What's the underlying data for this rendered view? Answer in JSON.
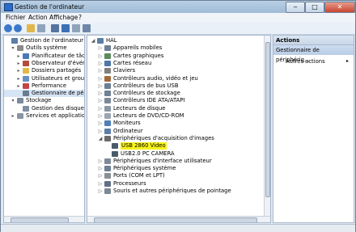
{
  "window": {
    "title": "Gestion de l'ordinateur"
  },
  "menu": [
    "Fichier",
    "Action",
    "Affichage",
    "?"
  ],
  "left_tree": [
    {
      "label": "Gestion de l'ordinateur (local)",
      "indent": 0,
      "exp": "",
      "icon": "computer-icon",
      "color": "#5a7ea8"
    },
    {
      "label": "Outils système",
      "indent": 1,
      "exp": "▾",
      "icon": "tools-icon",
      "color": "#8a8a8a"
    },
    {
      "label": "Planificateur de tâches",
      "indent": 2,
      "exp": "▸",
      "icon": "clock-icon",
      "color": "#4c78b8"
    },
    {
      "label": "Observateur d'événeme",
      "indent": 2,
      "exp": "▸",
      "icon": "event-icon",
      "color": "#b54b3a"
    },
    {
      "label": "Dossiers partagés",
      "indent": 2,
      "exp": "▸",
      "icon": "folder-icon",
      "color": "#e2b84a"
    },
    {
      "label": "Utilisateurs et groupes l",
      "indent": 2,
      "exp": "▸",
      "icon": "users-icon",
      "color": "#6a8fc2"
    },
    {
      "label": "Performance",
      "indent": 2,
      "exp": "▸",
      "icon": "performance-icon",
      "color": "#c24545"
    },
    {
      "label": "Gestionnaire de périphé",
      "indent": 2,
      "exp": "",
      "icon": "device-manager-icon",
      "color": "#6b7c90",
      "selected": true
    },
    {
      "label": "Stockage",
      "indent": 1,
      "exp": "▾",
      "icon": "storage-icon",
      "color": "#7a8a9c"
    },
    {
      "label": "Gestion des disques",
      "indent": 2,
      "exp": "",
      "icon": "disk-icon",
      "color": "#7f8fa2"
    },
    {
      "label": "Services et applications",
      "indent": 1,
      "exp": "▸",
      "icon": "services-icon",
      "color": "#8a94a3"
    }
  ],
  "device_tree": [
    {
      "label": "HAL",
      "indent": 0,
      "exp": "◢",
      "icon": "computer-icon",
      "color": "#5a7ea8"
    },
    {
      "label": "Appareils mobiles",
      "indent": 1,
      "exp": "▷",
      "icon": "mobile-icon",
      "color": "#6e7f93"
    },
    {
      "label": "Cartes graphiques",
      "indent": 1,
      "exp": "▷",
      "icon": "display-adapter-icon",
      "color": "#5b8a5b"
    },
    {
      "label": "Cartes réseau",
      "indent": 1,
      "exp": "▷",
      "icon": "network-icon",
      "color": "#4d77a8"
    },
    {
      "label": "Claviers",
      "indent": 1,
      "exp": "▷",
      "icon": "keyboard-icon",
      "color": "#7f7f7f"
    },
    {
      "label": "Contrôleurs audio, vidéo et jeu",
      "indent": 1,
      "exp": "▷",
      "icon": "audio-icon",
      "color": "#a06b3b"
    },
    {
      "label": "Contrôleurs de bus USB",
      "indent": 1,
      "exp": "▷",
      "icon": "usb-icon",
      "color": "#6b7f95"
    },
    {
      "label": "Contrôleurs de stockage",
      "indent": 1,
      "exp": "▷",
      "icon": "storage-controller-icon",
      "color": "#708096"
    },
    {
      "label": "Contrôleurs IDE ATA/ATAPI",
      "indent": 1,
      "exp": "▷",
      "icon": "ide-icon",
      "color": "#7b8797"
    },
    {
      "label": "Lecteurs de disque",
      "indent": 1,
      "exp": "▷",
      "icon": "drive-icon",
      "color": "#8b97a6"
    },
    {
      "label": "Lecteurs de DVD/CD-ROM",
      "indent": 1,
      "exp": "▷",
      "icon": "dvd-icon",
      "color": "#9aa5b2"
    },
    {
      "label": "Moniteurs",
      "indent": 1,
      "exp": "▷",
      "icon": "monitor-icon",
      "color": "#4f7fb5"
    },
    {
      "label": "Ordinateur",
      "indent": 1,
      "exp": "▷",
      "icon": "computer-icon",
      "color": "#5a7ea8"
    },
    {
      "label": "Périphériques d'acquisition d'images",
      "indent": 1,
      "exp": "◢",
      "icon": "camera-icon",
      "color": "#6a6a6a"
    },
    {
      "label": "USB 2860 Video",
      "indent": 2,
      "exp": "",
      "icon": "camera-icon",
      "color": "#4a5a6a",
      "highlight": true
    },
    {
      "label": "USB2.0 PC CAMERA",
      "indent": 2,
      "exp": "",
      "icon": "camera-icon",
      "color": "#4a5a6a"
    },
    {
      "label": "Périphériques d'interface utilisateur",
      "indent": 1,
      "exp": "▷",
      "icon": "hid-icon",
      "color": "#7f8a98"
    },
    {
      "label": "Périphériques système",
      "indent": 1,
      "exp": "▷",
      "icon": "system-icon",
      "color": "#6d7f94"
    },
    {
      "label": "Ports (COM et LPT)",
      "indent": 1,
      "exp": "▷",
      "icon": "port-icon",
      "color": "#8a8f96"
    },
    {
      "label": "Processeurs",
      "indent": 1,
      "exp": "▷",
      "icon": "cpu-icon",
      "color": "#5f7086"
    },
    {
      "label": "Souris et autres périphériques de pointage",
      "indent": 1,
      "exp": "▷",
      "icon": "mouse-icon",
      "color": "#7d8896"
    }
  ],
  "actions": {
    "header": "Actions",
    "selected": "Gestionnaire de périphériq...",
    "item": "Autres actions"
  }
}
